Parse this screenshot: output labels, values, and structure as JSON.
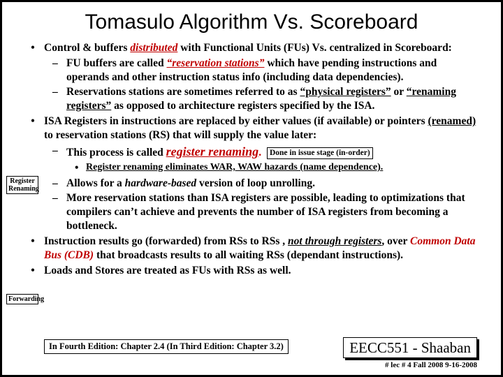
{
  "title": "Tomasulo Algorithm Vs. Scoreboard",
  "p1a": "Control & buffers ",
  "p1b": "distributed",
  "p1c": "  with Functional Units (FUs) Vs.  centralized in Scoreboard:",
  "p1_1a": "FU buffers are called ",
  "p1_1b": "“reservation stations”",
  "p1_1c": " which have pending instructions and operands and other instruction status info (including data dependencies).",
  "p1_2a": "Reservations stations are sometimes referred  to as ",
  "p1_2b": "“physical registers”",
  "p1_2c": "  or ",
  "p1_2d": "“renaming registers”",
  "p1_2e": "  as opposed to architecture registers specified by the ISA.",
  "p2a": "ISA Registers in instructions are replaced by either values (if available) or  pointers ",
  "p2b": "(renamed)",
  "p2c": " to reservation stations (RS) that will supply the value later:",
  "p2_1a": "This process is called ",
  "p2_1b": "register renaming",
  "p2_1c": ".",
  "issue": "Done in issue stage (in-order)",
  "p2_1_1": "Register renaming eliminates WAR, WAW hazards (name dependence).",
  "p2_2a": "Allows for a ",
  "p2_2b": "hardware-based",
  "p2_2c": " version of loop unrolling.",
  "p2_3": "More reservation stations than ISA registers are possible,  leading to optimizations that compilers can’t achieve and prevents the number of ISA registers from becoming a bottleneck.",
  "p3a": "Instruction results go (forwarded) from RSs to RSs , ",
  "p3b": "not through registers",
  "p3c": ", over ",
  "p3d": "Common Data Bus (CDB)",
  "p3e": " that broadcasts results to all waiting RSs (dependant instructions).",
  "p4": "Loads and Stores are treated as FUs with RSs as well.",
  "tagRR1": "Register",
  "tagRR2": "Renaming",
  "tagFwd": "Forwarding",
  "edition": "In Fourth Edition: Chapter 2.4 (In Third Edition: Chapter 3.2)",
  "course": "EECC551 - Shaaban",
  "sub": "#  lec # 4  Fall 2008    9-16-2008"
}
